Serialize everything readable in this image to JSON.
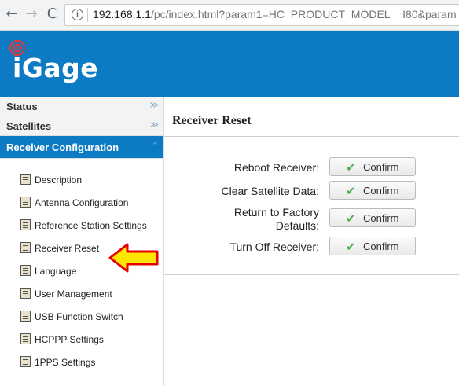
{
  "browser": {
    "back_icon": "←",
    "forward_icon": "→",
    "reload_icon": "C",
    "url_host": "192.168.1.1",
    "url_path": "/pc/index.html?param1=HC_PRODUCT_MODEL__I80&param"
  },
  "header": {
    "logo_text": "iGage",
    "accent": "#0c7bc3"
  },
  "sidebar": {
    "sections": [
      {
        "label": "Status",
        "chevron": "»"
      },
      {
        "label": "Satellites",
        "chevron": "»"
      },
      {
        "label": "Receiver Configuration",
        "chevron": "^"
      }
    ],
    "items": [
      {
        "label": "Description"
      },
      {
        "label": "Antenna Configuration"
      },
      {
        "label": "Reference Station Settings"
      },
      {
        "label": "Receiver Reset"
      },
      {
        "label": "Language"
      },
      {
        "label": "User Management"
      },
      {
        "label": "USB Function Switch"
      },
      {
        "label": "HCPPP Settings"
      },
      {
        "label": "1PPS Settings"
      }
    ]
  },
  "main": {
    "title": "Receiver Reset",
    "rows": [
      {
        "label": "Reboot Receiver:",
        "button": "Confirm"
      },
      {
        "label": "Clear Satellite Data:",
        "button": "Confirm"
      },
      {
        "label_line1": "Return to Factory",
        "label_line2": "Defaults:",
        "button": "Confirm"
      },
      {
        "label": "Turn Off Receiver:",
        "button": "Confirm"
      }
    ]
  }
}
